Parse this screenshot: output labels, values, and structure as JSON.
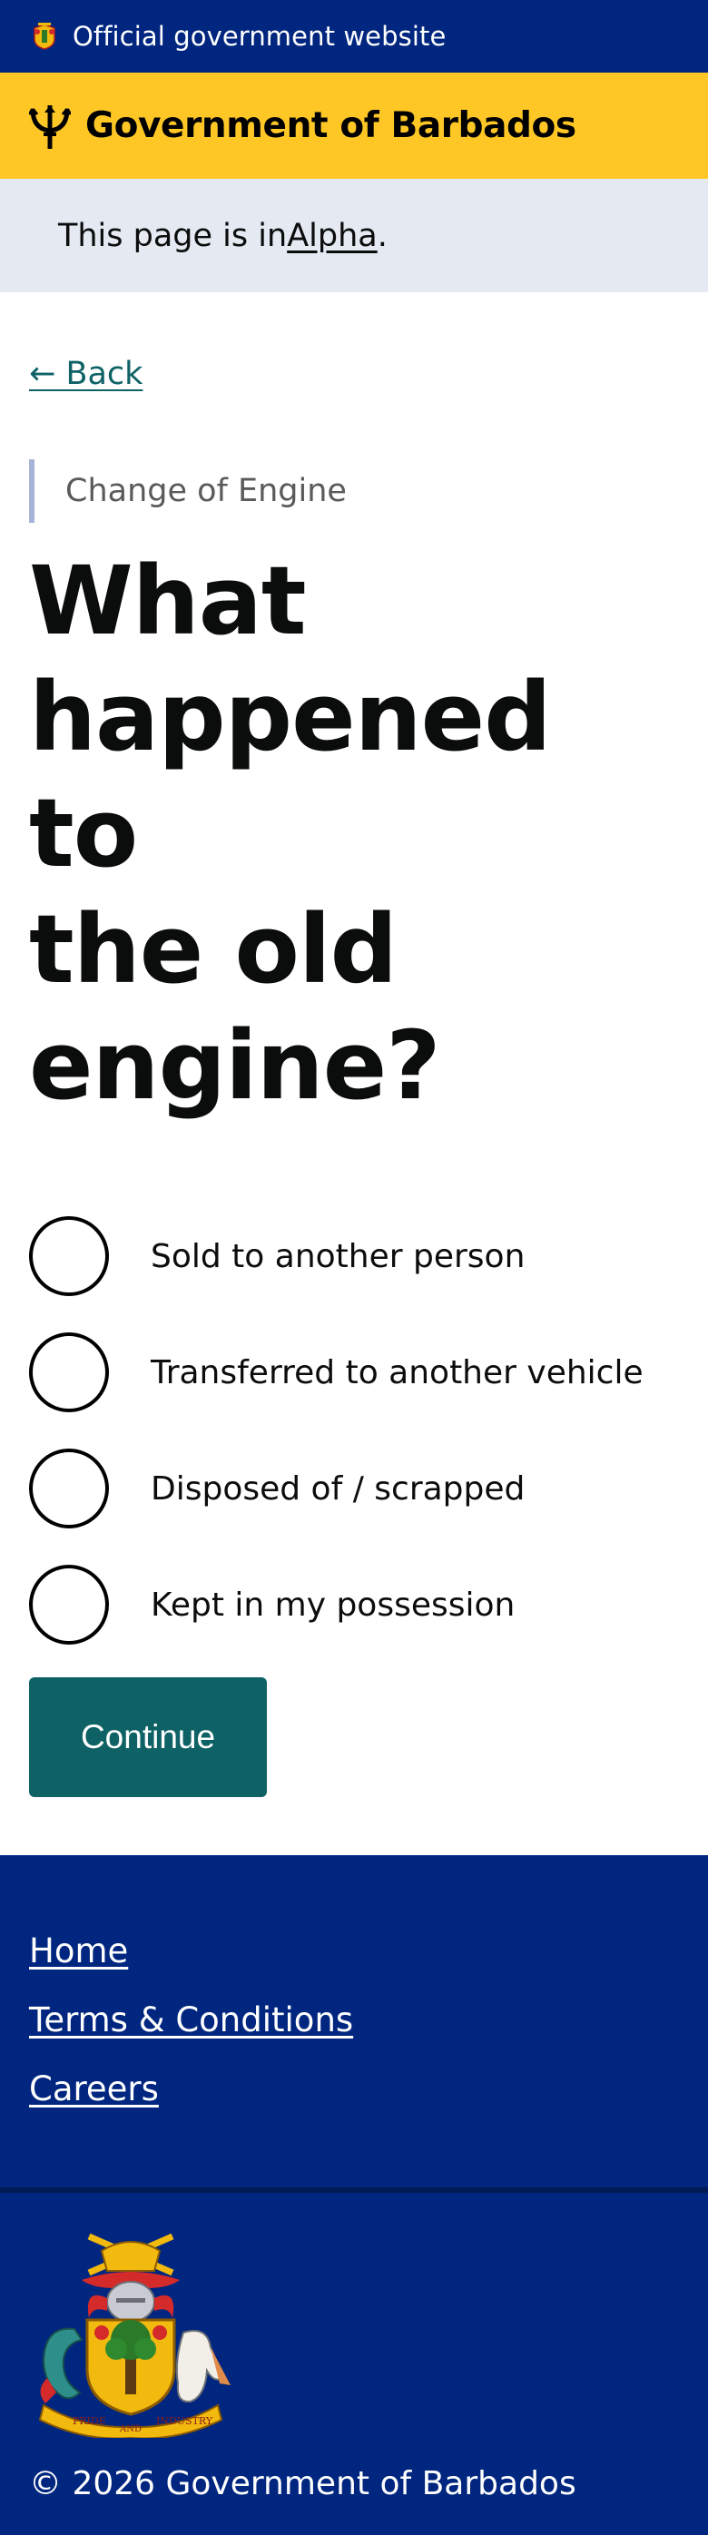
{
  "banner": {
    "text": "Official government website",
    "icon": "barbados-crest-icon"
  },
  "header": {
    "title": "Government of Barbados",
    "icon": "trident-icon"
  },
  "phase": {
    "prefix": "This page is in ",
    "link": "Alpha",
    "suffix": "."
  },
  "back_link": "← Back",
  "caption": "Change of Engine",
  "heading_lines": [
    "What",
    "happened to",
    "the old",
    "engine?"
  ],
  "options": [
    {
      "label": "Sold to another person",
      "selected": false
    },
    {
      "label": "Transferred to another vehicle",
      "selected": false
    },
    {
      "label": "Disposed of / scrapped",
      "selected": false
    },
    {
      "label": "Kept in my possession",
      "selected": false
    }
  ],
  "continue_label": "Continue",
  "footer": {
    "links": [
      "Home",
      "Terms & Conditions",
      "Careers"
    ],
    "coat_of_arms_motto": [
      "PRIDE",
      "AND",
      "INDUSTRY"
    ],
    "copyright": "© 2026 Government of Barbados"
  },
  "colors": {
    "navy": "#00267f",
    "gold": "#ffc726",
    "teal": "#0e6266",
    "phase_bg": "#e4e9f2"
  }
}
